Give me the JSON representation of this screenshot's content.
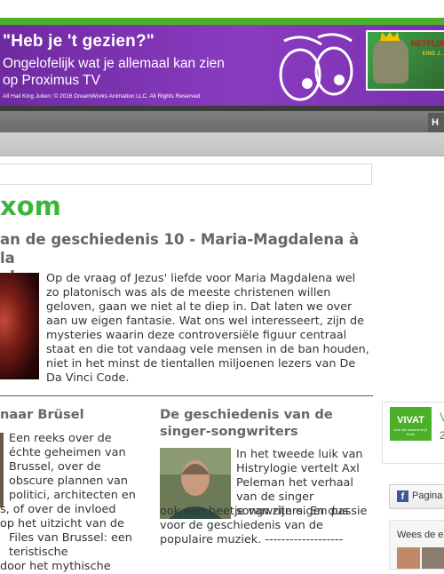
{
  "banner": {
    "headline": "\"Heb je 't gezien?\"",
    "line1": "Ongelofelijk wat je allemaal kan zien",
    "line2": "op Proximus TV",
    "legal": "All Hail King Julien: © 2016 DreamWorks Animation LLC. All Rights Reserved",
    "promo_brand": "NETFLIX",
    "promo_small": "KING J..."
  },
  "nav": {
    "tab_partial": "H"
  },
  "section": {
    "title": "xom"
  },
  "article_main": {
    "title_line1": "an de geschiedenis 10 - Maria-Magdalena à la",
    "title_line2": "ale",
    "body": "Op de vraag of Jezus' liefde voor Maria Magdalena wel zo platonisch was als de meeste christenen willen geloven, gaan we niet al te diep in. Dat laten we over aan uw eigen fantasie. Wat ons wel interesseert, zijn de mysteries waarin deze controversiële figuur centraal staat en die tot vandaag vele mensen in de ban houden, niet in het minst de tientallen miljoenen lezers van De Da Vinci Code."
  },
  "article_left": {
    "title": "naar Brüsel",
    "lines": [
      "Een reeks over de",
      "échte geheimen van",
      "Brussel, over de",
      "obscure plannen van",
      "politici, architecten en",
      "s, of over de invloed",
      " op het uitzicht van de",
      "Files van Brussel: een",
      "teristische",
      " door het mythische"
    ]
  },
  "article_right": {
    "title": "De geschiedenis van de singer-songwriters",
    "body": "In het tweede luik van Histrylogie vertelt Axl Peleman het verhaal van de singer songwriters. En dus",
    "body_more": "ook een beetje van zijn eigen passie voor de geschiedenis van de populaire muziek. -------------------"
  },
  "sidebar": {
    "vivat_logo": "VIVAT",
    "vivat_tagline": "voor elk moment in je leven",
    "vivat_name_partial": "V",
    "vivat_count_partial": "2",
    "fb_label": "Pagina",
    "friends_label": "Wees de e"
  }
}
